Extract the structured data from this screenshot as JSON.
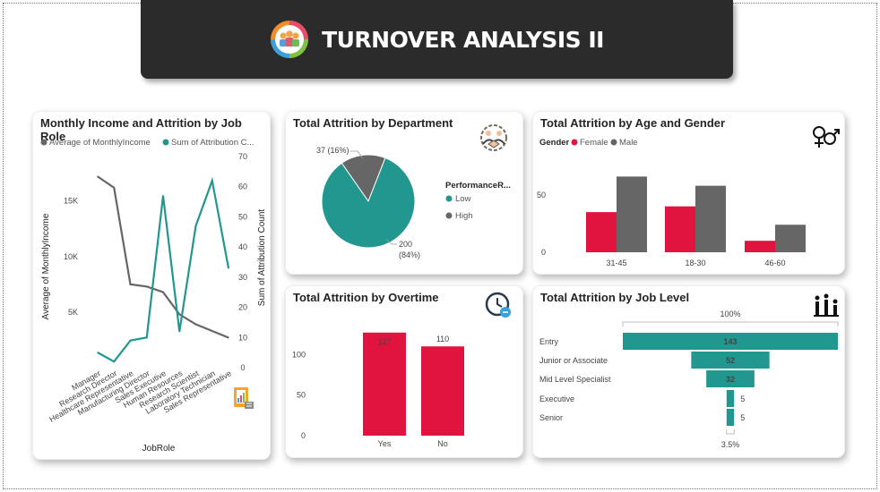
{
  "banner": {
    "title": "TURNOVER ANALYSIS II",
    "icon": "team-icon"
  },
  "colors": {
    "teal": "#21978f",
    "gray": "#666666",
    "red": "#e1133f",
    "dark": "#252423"
  },
  "cards": {
    "job_role": {
      "title": "Monthly Income and Attrition by Job Role",
      "icon": "report-icon"
    },
    "department": {
      "title": "Total Attrition by Department",
      "icon": "handshake-icon"
    },
    "age_gender": {
      "title": "Total Attrition by Age and Gender",
      "icon": "gender-icon"
    },
    "overtime": {
      "title": "Total Attrition by Overtime",
      "icon": "clock-icon"
    },
    "job_level": {
      "title": "Total Attrition by Job Level",
      "icon": "hierarchy-icon"
    }
  },
  "chart_data": [
    {
      "id": "job_role",
      "type": "line",
      "title": "Monthly Income and Attrition by Job Role",
      "xlabel": "JobRole",
      "ylabel_left": "Average of MonthlyIncome",
      "ylabel_right": "Sum of Attribution Count",
      "categories": [
        "Manager",
        "Research Director",
        "Healthcare Representative",
        "Manufacturing Director",
        "Sales Executive",
        "Human Resources",
        "Research Scientist",
        "Laboratory Technician",
        "Sales Representative"
      ],
      "left_ticks": [
        "5K",
        "10K",
        "15K"
      ],
      "left_tick_values": [
        5000,
        10000,
        15000
      ],
      "ylim_left": [
        0,
        19000
      ],
      "right_ticks": [
        "0",
        "10",
        "20",
        "30",
        "40",
        "50",
        "60",
        "70"
      ],
      "ylim_right": [
        0,
        70
      ],
      "legend": {
        "series_left": "Average of MonthlyIncome",
        "series_right": "Sum of Attribution C..."
      },
      "series": [
        {
          "name": "Average of MonthlyIncome",
          "axis": "left",
          "values": [
            17200,
            16200,
            7500,
            7300,
            6800,
            4800,
            3900,
            3300,
            2700
          ]
        },
        {
          "name": "Sum of Attribution C...",
          "axis": "right",
          "values": [
            5,
            2,
            9,
            10,
            57,
            12,
            47,
            62,
            33
          ]
        }
      ]
    },
    {
      "id": "department",
      "type": "pie",
      "title": "Total Attrition by Department",
      "legend_title": "PerformanceR...",
      "slices": [
        {
          "name": "Low",
          "value": 200,
          "label": "200",
          "pct_label": "(84%)"
        },
        {
          "name": "High",
          "value": 37,
          "label": "37 (16%)"
        }
      ]
    },
    {
      "id": "age_gender",
      "type": "bar",
      "title": "Total Attrition by Age and Gender",
      "legend_title": "Gender",
      "categories": [
        "31-45",
        "18-30",
        "46-60"
      ],
      "ticks": [
        "0",
        "50"
      ],
      "ylim": [
        0,
        85
      ],
      "series": [
        {
          "name": "Female",
          "values": [
            35,
            40,
            10
          ]
        },
        {
          "name": "Male",
          "values": [
            66,
            58,
            24
          ]
        }
      ]
    },
    {
      "id": "overtime",
      "type": "bar",
      "title": "Total Attrition by Overtime",
      "categories": [
        "Yes",
        "No"
      ],
      "values": [
        127,
        110
      ],
      "labels": [
        "127",
        "110"
      ],
      "ticks": [
        "0",
        "50",
        "100"
      ],
      "ylim": [
        0,
        140
      ]
    },
    {
      "id": "job_level",
      "type": "bar",
      "title": "Total Attrition by Job Level",
      "categories": [
        "Entry",
        "Junior or Associate",
        "Mid Level Specialist",
        "Executive",
        "Senior"
      ],
      "values": [
        143,
        52,
        32,
        5,
        5
      ],
      "labels": [
        "143",
        "52",
        "32",
        "5",
        "5"
      ],
      "top_label": "100%",
      "bottom_label": "3.5%"
    }
  ]
}
